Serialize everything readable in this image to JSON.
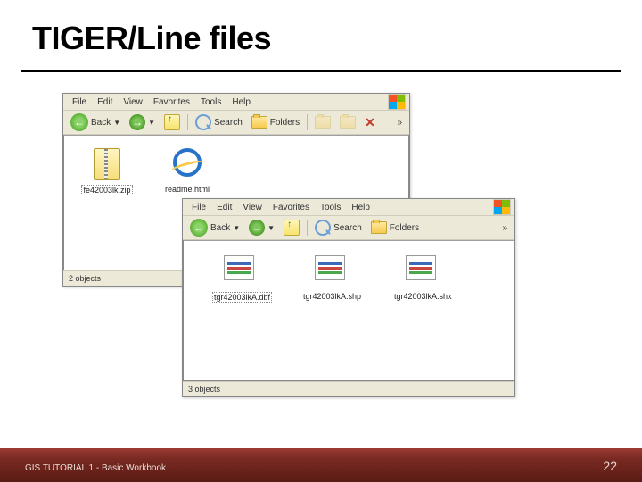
{
  "slide": {
    "title": "TIGER/Line files",
    "footer": "GIS TUTORIAL 1 - Basic Workbook",
    "page_number": "22"
  },
  "menus": {
    "file": "File",
    "edit": "Edit",
    "view": "View",
    "favorites": "Favorites",
    "tools": "Tools",
    "help": "Help"
  },
  "toolbar": {
    "back": "Back",
    "search": "Search",
    "folders": "Folders",
    "overflow": "»"
  },
  "window1": {
    "files": {
      "zip_name": "fe42003lk.zip",
      "html_name": "readme.html"
    },
    "status": "2 objects"
  },
  "window2": {
    "files": {
      "dbf_name": "tgr42003lkA.dbf",
      "shp_name": "tgr42003lkA.shp",
      "shx_name": "tgr42003lkA.shx"
    },
    "status": "3 objects"
  }
}
